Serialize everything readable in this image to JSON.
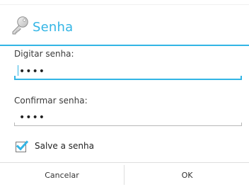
{
  "dialog": {
    "title": "Senha",
    "title_icon": "key-icon",
    "accent_color": "#33b5e5"
  },
  "fields": {
    "password": {
      "label": "Digitar senha:",
      "value": "••••"
    },
    "confirm": {
      "label": "Confirmar senha:",
      "value": "••••"
    }
  },
  "save_password": {
    "label": "Salve a senha",
    "checked": true,
    "icon": "checkmark-icon"
  },
  "buttons": {
    "cancel": "Cancelar",
    "ok": "OK"
  }
}
